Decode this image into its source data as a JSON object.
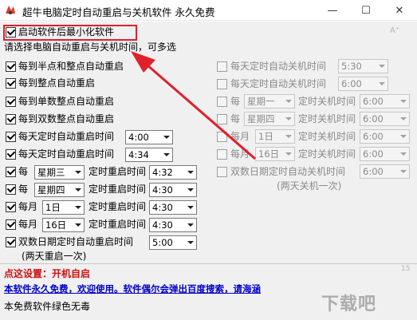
{
  "window": {
    "title": "超牛电脑定时自动重启与关机软件          永久免费",
    "minimize_glyph": "—",
    "maximize_glyph": "☐",
    "close_glyph": "✕"
  },
  "top": {
    "minimize_on_start_label": "启动软件后最小化软件",
    "minimize_on_start_checked": true,
    "instruction": "请选择电脑自动重启与关机时间，可多选",
    "font_icon": "A⁺"
  },
  "restart_options": [
    {
      "label": "每到半点和整点自动重启",
      "checked": true
    },
    {
      "label": "每到整点自动重启",
      "checked": true
    },
    {
      "label": "每到单数整点自动重启",
      "checked": true
    },
    {
      "label": "每到双数整点自动重启",
      "checked": true
    },
    {
      "label": "每天定时自动重启时间",
      "checked": true,
      "time": "4:00"
    },
    {
      "label": "每天定时自动重启时间",
      "checked": true,
      "time": "4:34"
    },
    {
      "prefix": "每",
      "day": "星期三",
      "label": "定时重启时间",
      "checked": true,
      "time": "4:32"
    },
    {
      "prefix": "每",
      "day": "星期四",
      "label": "定时重启时间",
      "checked": true,
      "time": "4:30"
    },
    {
      "prefix": "每月",
      "day": "1日",
      "label": "定时重启时间",
      "checked": true,
      "time": "4:30"
    },
    {
      "prefix": "每月",
      "day": "16日",
      "label": "定时重启时间",
      "checked": true,
      "time": "4:30"
    },
    {
      "label": "双数日期定时自动重启时间",
      "checked": true,
      "time": "5:00"
    }
  ],
  "restart_note": "(两天重启一次)",
  "shutdown_options": [
    {
      "label": "每天定时自动关机时间",
      "checked": false,
      "time": "5:30"
    },
    {
      "label": "每天定时自动关机时间",
      "checked": false,
      "time": "6:00"
    },
    {
      "prefix": "每",
      "day": "星期一",
      "label": "定时关机时间",
      "checked": false,
      "time": "6:00"
    },
    {
      "prefix": "每",
      "day": "星期四",
      "label": "定时关机时间",
      "checked": false,
      "time": "6:00"
    },
    {
      "prefix": "每月",
      "day": "1日",
      "label": "定时关机时间",
      "checked": false,
      "time": "6:00"
    },
    {
      "prefix": "每月",
      "day": "16日",
      "label": "定时关机时间",
      "checked": false,
      "time": "6:00"
    },
    {
      "label": "双数日期定时自动关机时间",
      "checked": false,
      "time": "6:00"
    }
  ],
  "shutdown_note": "(两天关机一次)",
  "footer": {
    "settings_label": "点这设置：开机自启",
    "notice": "本软件永久免费，欢迎使用。软件偶尔会弹出百度搜索，请海涵",
    "green_notice": "本免费软件绿色无毒",
    "version": "15",
    "watermark": "下载吧"
  },
  "colors": {
    "highlight": "#e0202a",
    "settings_text": "#d01010",
    "notice_text": "#0000cc"
  }
}
